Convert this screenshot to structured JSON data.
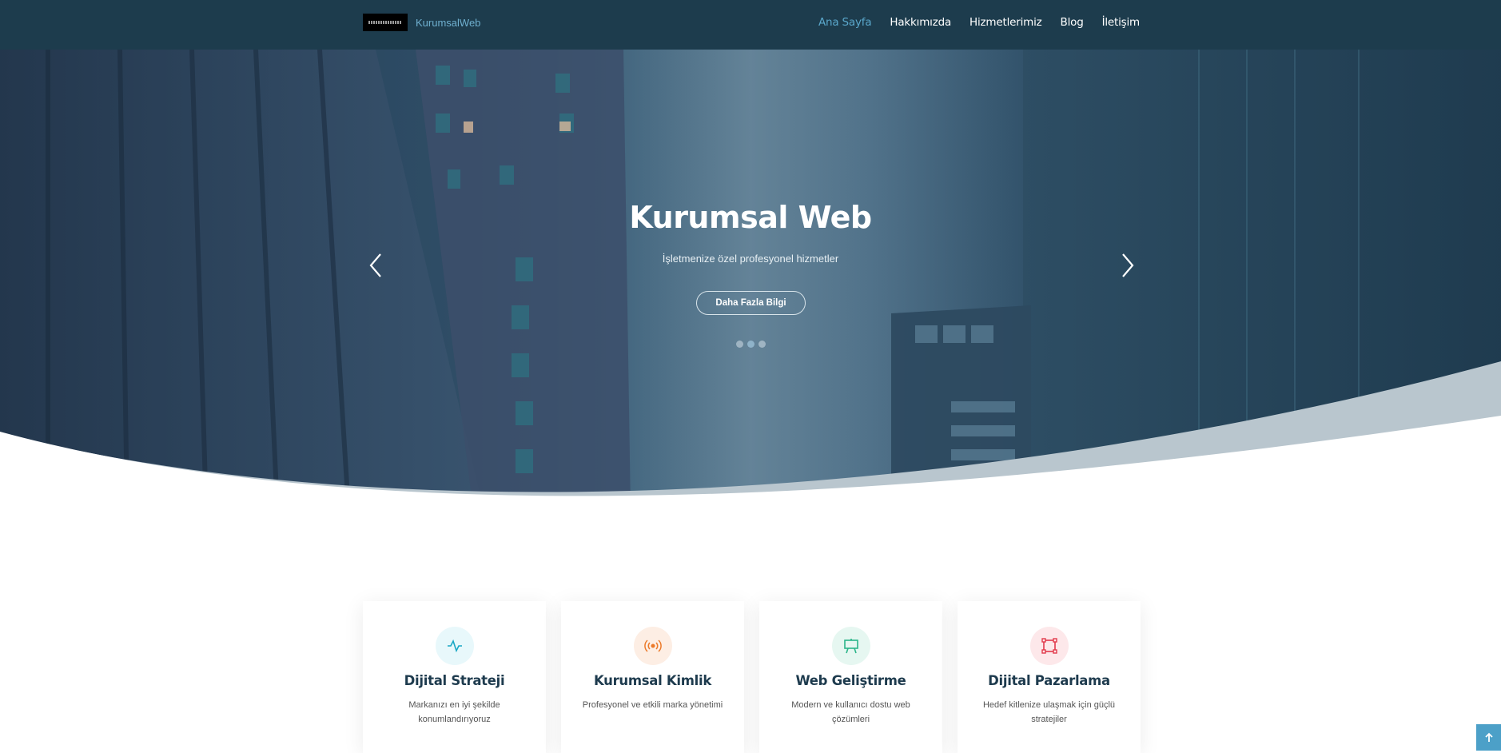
{
  "header": {
    "logo_text": "KurumsalWeb",
    "nav": [
      "Ana Sayfa",
      "Hakkımızda",
      "Hizmetlerimiz",
      "Blog",
      "İletişim"
    ]
  },
  "hero": {
    "title": "Kurumsal Web",
    "subtitle": "İşletmenize özel profesyonel hizmetler",
    "button": "Daha Fazla Bilgi",
    "slides_count": 3,
    "active_slide": 2
  },
  "cards": [
    {
      "icon": "activity-icon",
      "icon_color": "#1aa8c5",
      "icon_bg": "#e8f8fb",
      "title": "Dijital Strateji",
      "desc": "Markanızı en iyi şekilde konumlandırıyoruz"
    },
    {
      "icon": "broadcast-icon",
      "icon_color": "#ec7a2a",
      "icon_bg": "#fdeee4",
      "title": "Kurumsal Kimlik",
      "desc": "Profesyonel ve etkili marka yönetimi"
    },
    {
      "icon": "easel-icon",
      "icon_color": "#2bb58a",
      "icon_bg": "#e6f7f1",
      "title": "Web Geliştirme",
      "desc": "Modern ve kullanıcı dostu web çözümleri"
    },
    {
      "icon": "bounding-box-icon",
      "icon_color": "#e23a4c",
      "icon_bg": "#fde8ea",
      "title": "Dijital Pazarlama",
      "desc": "Hedef kitlenize ulaşmak için güçlü stratejiler"
    }
  ],
  "colors": {
    "header_bg": "#1d3c4d",
    "accent": "#5aa7cb",
    "title_color": "#1e3b4e",
    "back_to_top": "#4ca0c8"
  }
}
